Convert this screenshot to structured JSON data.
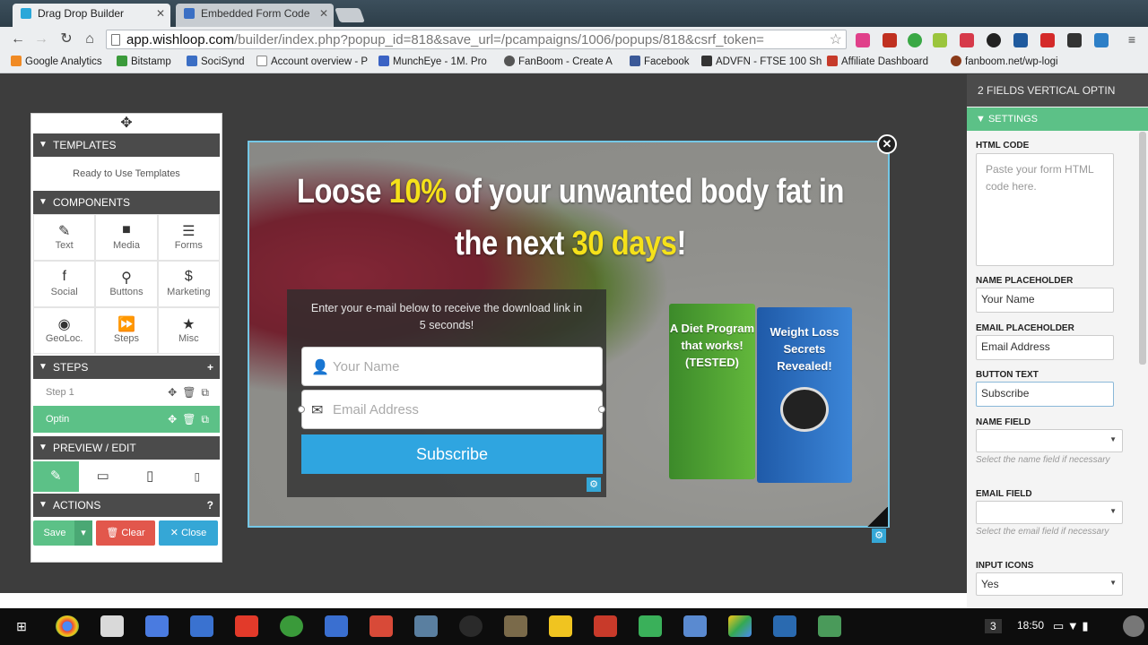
{
  "browser": {
    "tabs": [
      {
        "title": "Drag Drop Builder",
        "color": "#2aa7d9"
      },
      {
        "title": "Embedded Form Code",
        "color": "#3a6fc4"
      }
    ],
    "url_host": "app.wishloop.com",
    "url_path": "/builder/index.php?popup_id=818&save_url=/pcampaigns/1006/popups/818&csrf_token=",
    "bookmarks": [
      "Google Analytics",
      "Bitstamp",
      "SociSynd",
      "Account overview - P",
      "MunchEye - 1M. Pro",
      "FanBoom - Create A",
      "Facebook",
      "ADVFN - FTSE 100 Sh",
      "Affiliate Dashboard",
      "fanboom.net/wp-logi"
    ]
  },
  "left_panel": {
    "move_glyph": "✥",
    "templates": {
      "header": "TEMPLATES",
      "link": "Ready to Use Templates"
    },
    "components": {
      "header": "COMPONENTS",
      "items": [
        {
          "label": "Text",
          "icon": "✎"
        },
        {
          "label": "Media",
          "icon": "■"
        },
        {
          "label": "Forms",
          "icon": "☰"
        },
        {
          "label": "Social",
          "icon": "f"
        },
        {
          "label": "Buttons",
          "icon": "⚲"
        },
        {
          "label": "Marketing",
          "icon": "$"
        },
        {
          "label": "GeoLoc.",
          "icon": "◉"
        },
        {
          "label": "Steps",
          "icon": "⏩"
        },
        {
          "label": "Misc",
          "icon": "★"
        }
      ]
    },
    "steps": {
      "header": "STEPS",
      "add": "+",
      "rows": [
        "Step 1",
        "Optin"
      ]
    },
    "preview": {
      "header": "PREVIEW / EDIT"
    },
    "actions": {
      "header": "ACTIONS",
      "help": "?",
      "save": "Save",
      "clear": "Clear",
      "close": "Close"
    }
  },
  "popup": {
    "headline_a": "Loose ",
    "headline_hl1": "10%",
    "headline_b": " of your unwanted body fat in",
    "headline_c": "the next ",
    "headline_hl2": "30 days",
    "headline_d": "!",
    "intro": "Enter your e-mail below to receive the download link in 5 seconds!",
    "name_placeholder": "Your Name",
    "email_placeholder": "Email Address",
    "button": "Subscribe",
    "book1": "A Diet Program that works! (TESTED)",
    "book2": "Weight Loss Secrets Revealed!"
  },
  "right_panel": {
    "title": "2 FIELDS VERTICAL OPTIN",
    "section": "SETTINGS",
    "html_code_label": "HTML CODE",
    "html_code_placeholder": "Paste your form HTML code here.",
    "name_placeholder_label": "NAME PLACEHOLDER",
    "name_placeholder_value": "Your Name",
    "email_placeholder_label": "EMAIL PLACEHOLDER",
    "email_placeholder_value": "Email Address",
    "button_text_label": "BUTTON TEXT",
    "button_text_value": "Subscribe",
    "name_field_label": "NAME FIELD",
    "name_field_help": "Select the name field if necessary",
    "email_field_label": "EMAIL FIELD",
    "email_field_help": "Select the email field if necessary",
    "input_icons_label": "INPUT ICONS",
    "input_icons_value": "Yes"
  },
  "taskbar": {
    "badge": "3",
    "time": "18:50"
  }
}
